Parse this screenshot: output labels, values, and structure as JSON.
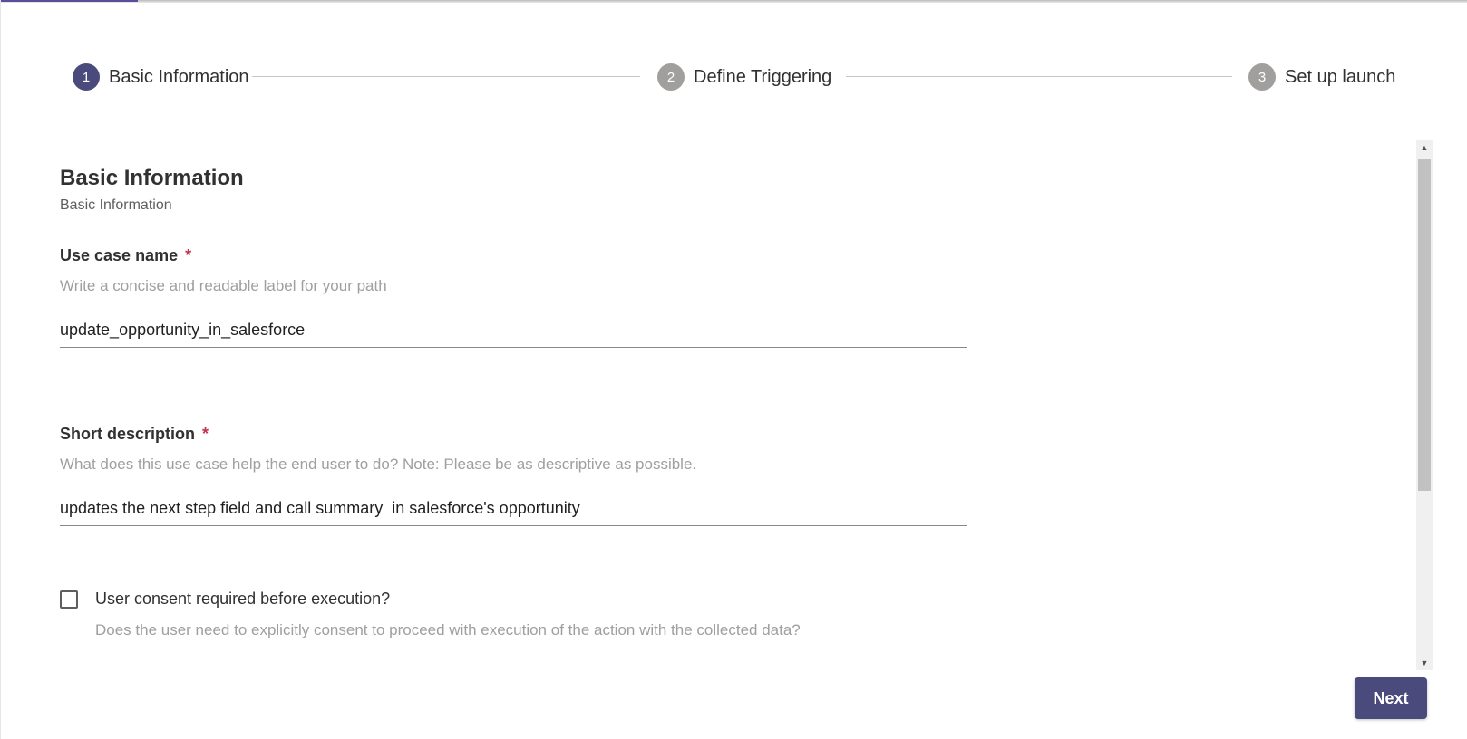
{
  "stepper": {
    "steps": [
      {
        "number": "1",
        "label": "Basic Information",
        "state": "active"
      },
      {
        "number": "2",
        "label": "Define Triggering",
        "state": "inactive"
      },
      {
        "number": "3",
        "label": "Set up launch",
        "state": "inactive"
      }
    ]
  },
  "section": {
    "title": "Basic Information",
    "subtitle": "Basic Information"
  },
  "fields": {
    "use_case_name": {
      "label": "Use case name",
      "required_mark": "*",
      "hint": "Write a concise and readable label for your path",
      "value": "update_opportunity_in_salesforce"
    },
    "short_description": {
      "label": "Short description",
      "required_mark": "*",
      "hint": "What does this use case help the end user to do? Note: Please be as descriptive as possible.",
      "value": "updates the next step field and call summary  in salesforce's opportunity"
    }
  },
  "consent": {
    "label": "User consent required before execution?",
    "hint": "Does the user need to explicitly consent to proceed with execution of the action with the collected data?",
    "checked": false
  },
  "footer": {
    "next_label": "Next"
  },
  "colors": {
    "accent": "#4b4a7d",
    "inactive_step": "#a19f9d",
    "required": "#c4314b"
  },
  "icons": {
    "scroll_up": "triangle-up-icon",
    "scroll_down": "triangle-down-icon"
  }
}
